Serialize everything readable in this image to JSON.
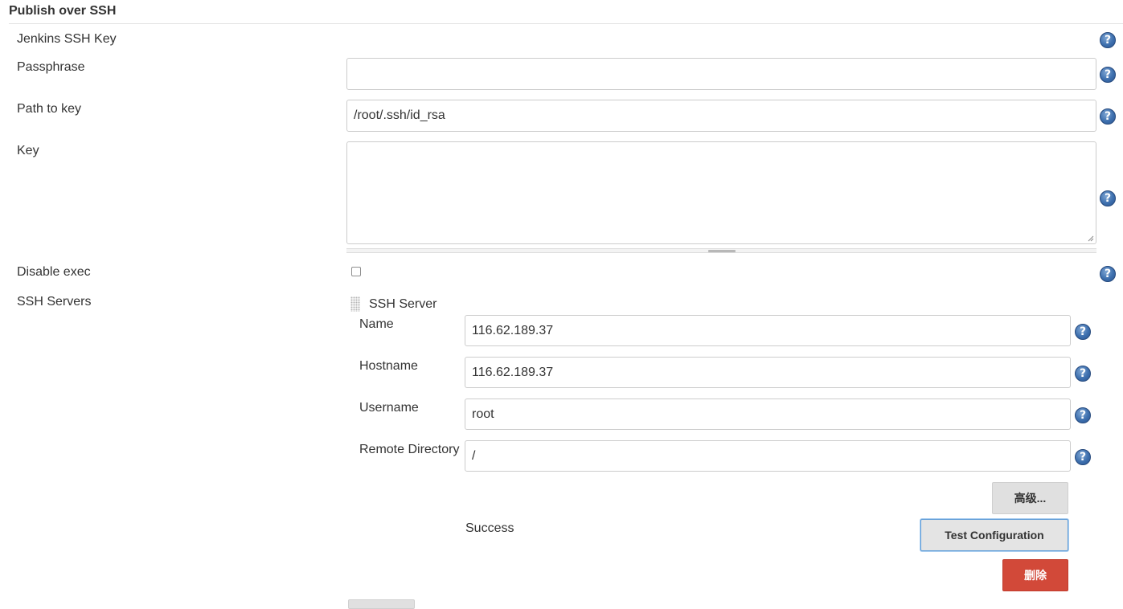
{
  "section": {
    "title": "Publish over SSH"
  },
  "fields": {
    "jenkins_ssh_key": {
      "label": "Jenkins SSH Key"
    },
    "passphrase": {
      "label": "Passphrase",
      "value": ""
    },
    "path_to_key": {
      "label": "Path to key",
      "value": "/root/.ssh/id_rsa"
    },
    "key": {
      "label": "Key",
      "value": ""
    },
    "disable_exec": {
      "label": "Disable exec",
      "checked": false
    }
  },
  "ssh_servers": {
    "label": "SSH Servers",
    "server": {
      "header": "SSH Server",
      "name": {
        "label": "Name",
        "value": "116.62.189.37"
      },
      "hostname": {
        "label": "Hostname",
        "value": "116.62.189.37"
      },
      "username": {
        "label": "Username",
        "value": "root"
      },
      "remote_directory": {
        "label": "Remote Directory",
        "value": "/"
      },
      "advanced_button": "高级...",
      "test_status": "Success",
      "test_button": "Test Configuration",
      "delete_button": "删除"
    }
  },
  "icons": {
    "help": "help-icon",
    "drag": "drag-handle-icon"
  },
  "colors": {
    "help_blue": "#3d6fae",
    "delete_red": "#d24939",
    "focus_blue": "#5d9cd8"
  },
  "help_glyph": "?"
}
